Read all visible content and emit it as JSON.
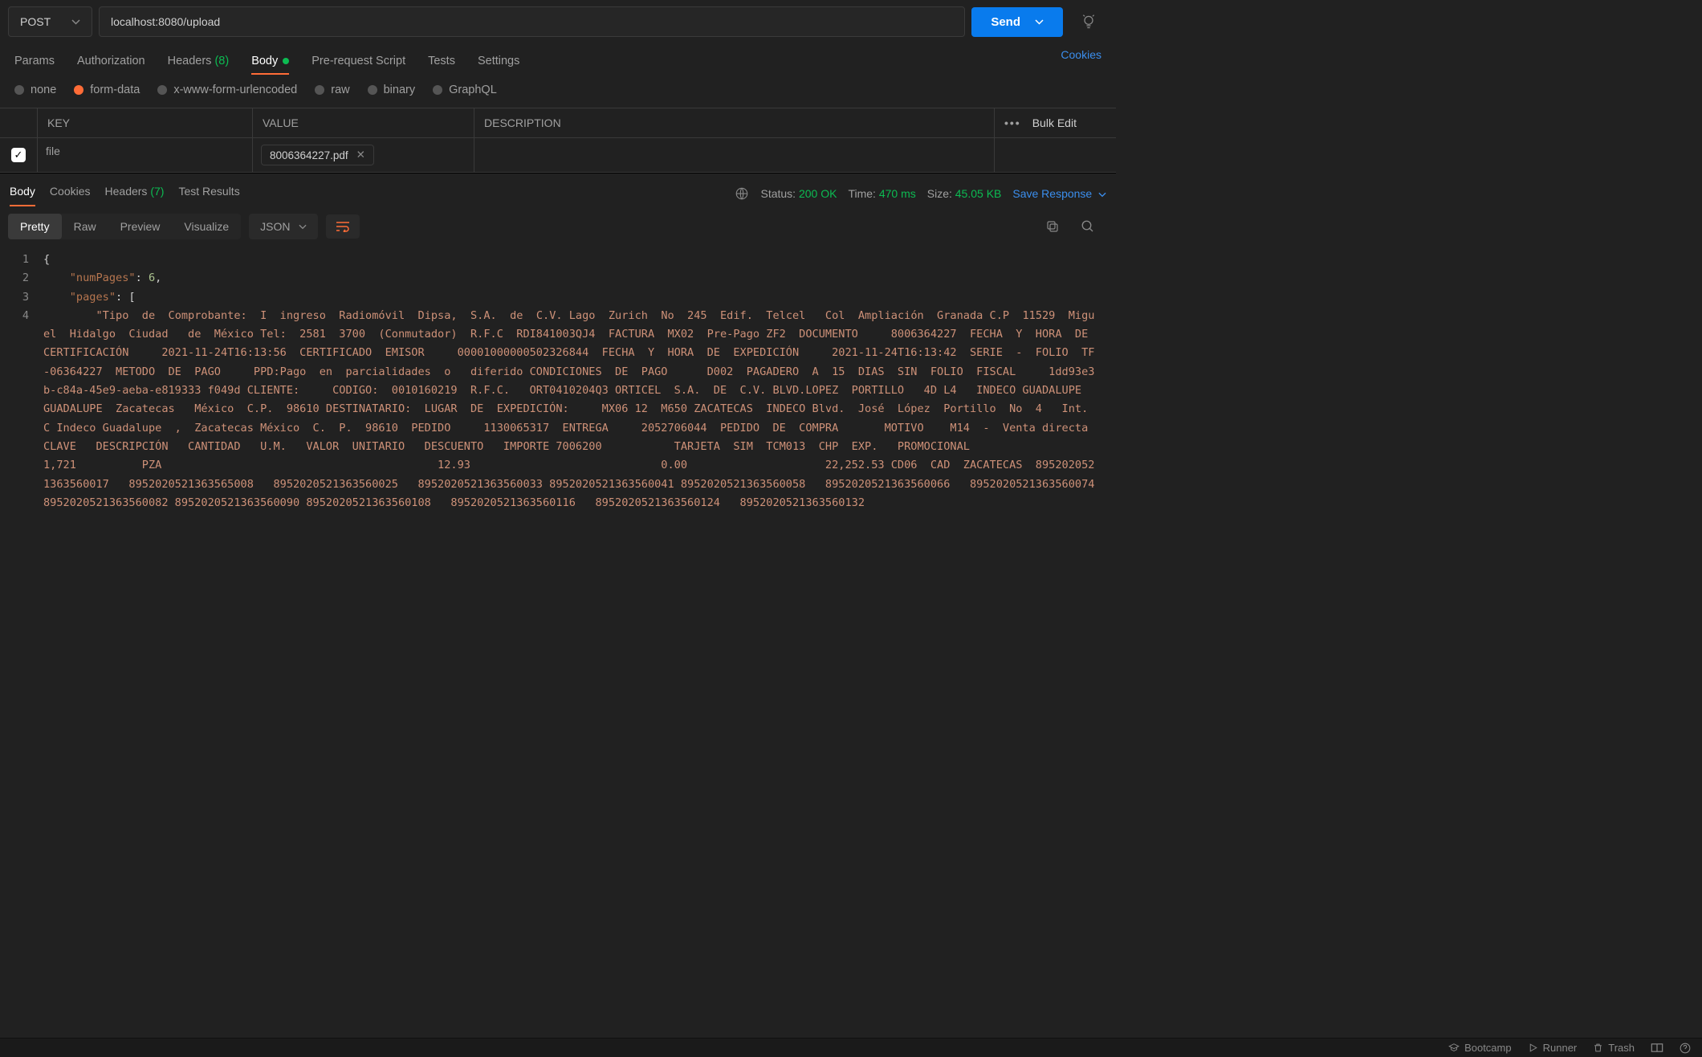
{
  "request": {
    "method": "POST",
    "url": "localhost:8080/upload",
    "send": "Send"
  },
  "tabs": {
    "params": "Params",
    "auth": "Authorization",
    "headers_label": "Headers",
    "headers_count": "(8)",
    "body": "Body",
    "prerequest": "Pre-request Script",
    "tests": "Tests",
    "settings": "Settings",
    "cookies": "Cookies"
  },
  "body_types": {
    "none": "none",
    "formdata": "form-data",
    "urlencoded": "x-www-form-urlencoded",
    "raw": "raw",
    "binary": "binary",
    "graphql": "GraphQL"
  },
  "kv": {
    "key_h": "KEY",
    "val_h": "VALUE",
    "desc_h": "DESCRIPTION",
    "bulk": "Bulk Edit",
    "row_key": "file",
    "row_file": "8006364227.pdf"
  },
  "resp_tabs": {
    "body": "Body",
    "cookies": "Cookies",
    "headers_label": "Headers",
    "headers_count": "(7)",
    "test": "Test Results"
  },
  "status": {
    "label": "Status:",
    "value": "200 OK",
    "time_label": "Time:",
    "time_value": "470 ms",
    "size_label": "Size:",
    "size_value": "45.05 KB",
    "save": "Save Response"
  },
  "view": {
    "pretty": "Pretty",
    "raw": "Raw",
    "preview": "Preview",
    "visualize": "Visualize",
    "format": "JSON"
  },
  "code": {
    "l1": "{",
    "l2_key": "\"numPages\"",
    "l2_val": "6",
    "l3_key": "\"pages\"",
    "l4": "\"Tipo  de  Comprobante:  I  ingreso  Radiomóvil  Dipsa,  S.A.  de  C.V. Lago  Zurich  No  245  Edif.  Telcel   Col  Ampliación  Granada C.P  11529  Miguel  Hidalgo  Ciudad   de  México Tel:  2581  3700  (Conmutador)  R.F.C  RDI841003QJ4  FACTURA  MX02  Pre-Pago ZF2  DOCUMENTO     8006364227  FECHA  Y  HORA  DE  CERTIFICACIÓN     2021-11-24T16:13:56  CERTIFICADO  EMISOR     00001000000502326844  FECHA  Y  HORA  DE  EXPEDICIÓN     2021-11-24T16:13:42  SERIE  -  FOLIO  TF-06364227  METODO  DE  PAGO     PPD:Pago  en  parcialidades  o   diferido CONDICIONES  DE  PAGO      D002  PAGADERO  A  15  DIAS  SIN  FOLIO  FISCAL     1dd93e3b-c84a-45e9-aeba-e819333 f049d CLIENTE:     CODIGO:  0010160219  R.F.C.   ORT0410204Q3 ORTICEL  S.A.  DE  C.V. BLVD.LOPEZ  PORTILLO   4D L4   INDECO GUADALUPE  GUADALUPE  Zacatecas   México  C.P.  98610 DESTINATARIO:  LUGAR  DE  EXPEDICIÓN:     MX06 12  M650 ZACATECAS  INDECO Blvd.  José  López  Portillo  No  4   Int.  C Indeco Guadalupe  ,  Zacatecas México  C.  P.  98610  PEDIDO     1130065317  ENTREGA     2052706044  PEDIDO  DE  COMPRA       MOTIVO    M14  -  Venta directa  CLAVE   DESCRIPCIÓN   CANTIDAD   U.M.   VALOR  UNITARIO   DESCUENTO   IMPORTE 7006200           TARJETA  SIM  TCM013  CHP  EXP.   PROMOCIONAL                                    1,721          PZA                                          12.93                             0.00                     22,252.53 CD06  CAD  ZACATECAS  8952020521363560017   8952020521363565008   8952020521363560025   8952020521363560033 8952020521363560041 8952020521363560058   8952020521363560066   8952020521363560074   8952020521363560082 8952020521363560090 8952020521363560108   8952020521363560116   8952020521363560124   8952020521363560132 "
  },
  "footer": {
    "bootcamp": "Bootcamp",
    "runner": "Runner",
    "trash": "Trash"
  }
}
